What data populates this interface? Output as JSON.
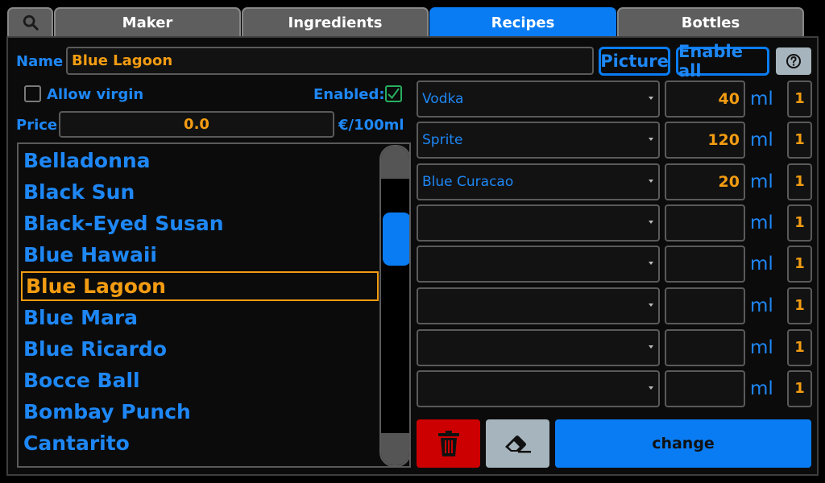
{
  "tabs": [
    {
      "label": "Maker"
    },
    {
      "label": "Ingredients"
    },
    {
      "label": "Recipes"
    },
    {
      "label": "Bottles"
    }
  ],
  "active_tab": "Recipes",
  "form": {
    "name_label": "Name",
    "name_value": "Blue Lagoon",
    "picture_label": "Picture",
    "enable_all_label": "Enable all",
    "help_icon": "question-circle-icon",
    "allow_virgin_label": "Allow virgin",
    "allow_virgin_checked": false,
    "enabled_label": "Enabled:",
    "enabled_checked": true,
    "price_label": "Price",
    "price_value": "0.0",
    "price_unit": "€/100ml"
  },
  "recipes": {
    "selected": "Blue Lagoon",
    "items": [
      "Belladonna",
      "Black Sun",
      "Black-Eyed Susan",
      "Blue Hawaii",
      "Blue Lagoon",
      "Blue Mara",
      "Blue Ricardo",
      "Bocce Ball",
      "Bombay Punch",
      "Cantarito"
    ]
  },
  "ingredients": [
    {
      "name": "Vodka",
      "amount": "40",
      "unit": "ml",
      "count": "1"
    },
    {
      "name": "Sprite",
      "amount": "120",
      "unit": "ml",
      "count": "1"
    },
    {
      "name": "Blue Curacao",
      "amount": "20",
      "unit": "ml",
      "count": "1"
    },
    {
      "name": "",
      "amount": "",
      "unit": "ml",
      "count": "1"
    },
    {
      "name": "",
      "amount": "",
      "unit": "ml",
      "count": "1"
    },
    {
      "name": "",
      "amount": "",
      "unit": "ml",
      "count": "1"
    },
    {
      "name": "",
      "amount": "",
      "unit": "ml",
      "count": "1"
    },
    {
      "name": "",
      "amount": "",
      "unit": "ml",
      "count": "1"
    }
  ],
  "actions": {
    "delete_icon": "trash-icon",
    "clear_icon": "eraser-icon",
    "change_label": "change"
  },
  "colors": {
    "accent": "#0a7cf3",
    "highlight": "#f39c12",
    "delete": "#cc0000",
    "clear": "#a6b4bd"
  }
}
